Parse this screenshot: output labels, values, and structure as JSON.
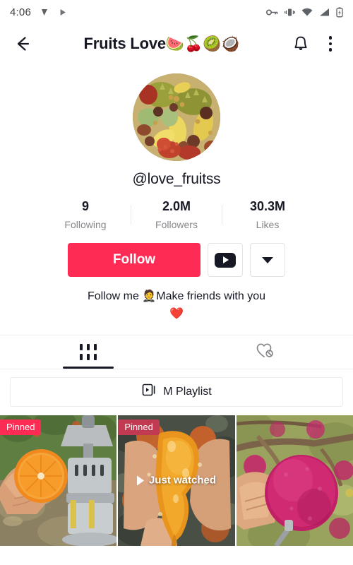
{
  "status_bar": {
    "time": "4:06",
    "left_icons": [
      "notification-triangle-icon",
      "play-store-icon"
    ],
    "right_icons": [
      "vpn-key-icon",
      "vibrate-icon",
      "wifi-icon",
      "signal-icon",
      "battery-charging-icon"
    ]
  },
  "header": {
    "back_icon": "back-arrow-icon",
    "title": "Fruits Love",
    "title_emojis": "🍉🍒🥝🥥",
    "bell_icon": "notification-bell-icon",
    "menu_icon": "more-options-icon"
  },
  "profile": {
    "avatar_alt": "tropical-fruits-photo",
    "username": "@love_fruitss",
    "stats": [
      {
        "value": "9",
        "label": "Following"
      },
      {
        "value": "2.0M",
        "label": "Followers"
      },
      {
        "value": "30.3M",
        "label": "Likes"
      }
    ],
    "bio_line1": "Follow me 🤵Make friends with you",
    "bio_line2": "❤️"
  },
  "actions": {
    "follow_label": "Follow",
    "follow_color": "#FE2C55",
    "youtube_icon": "youtube-icon",
    "more_icon": "chevron-down-icon"
  },
  "tabs": [
    {
      "name": "videos-tab",
      "icon": "grid-icon",
      "active": true
    },
    {
      "name": "liked-tab",
      "icon": "heart-private-icon",
      "active": false
    }
  ],
  "playlist": {
    "icon": "playlist-icon",
    "label": "M Playlist"
  },
  "videos": [
    {
      "alt": "hand-holding-halved-orange-by-juicer",
      "badge": "Pinned",
      "badge_color": "#FE2C55",
      "overlay": null
    },
    {
      "alt": "hands-squeezing-orange-juice",
      "badge": "Pinned",
      "badge_color": "#C23A52",
      "overlay": "Just watched"
    },
    {
      "alt": "hand-holding-pink-apple-on-tree",
      "badge": null,
      "overlay": null
    }
  ]
}
